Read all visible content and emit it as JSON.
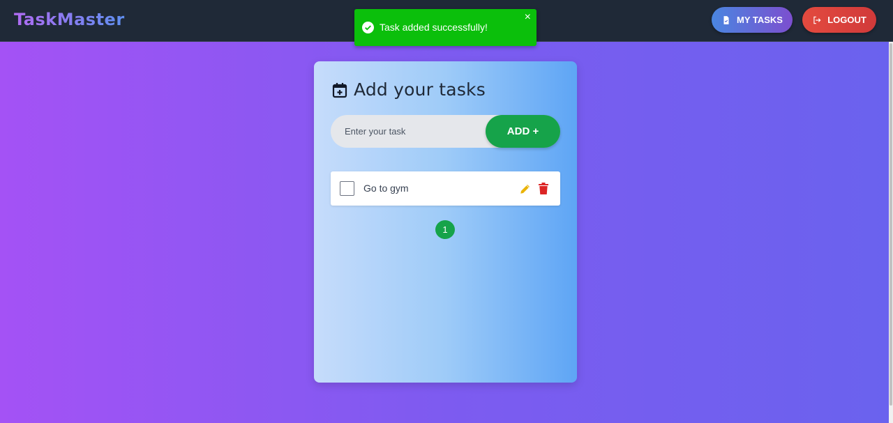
{
  "navbar": {
    "brand": "TaskMaster",
    "my_tasks_label": "MY TASKS",
    "logout_label": "LOGOUT",
    "my_tasks_icon": "document-icon",
    "logout_icon": "logout-icon"
  },
  "toast": {
    "message": "Task added successfully!",
    "close": "×",
    "icon": "check-circle-icon",
    "color": "#0bbf0b"
  },
  "card": {
    "title": "Add your tasks",
    "title_icon": "calendar-plus-icon",
    "input_placeholder": "Enter your task",
    "input_value": "",
    "add_label": "ADD +",
    "tasks": [
      {
        "text": "Go to gym",
        "completed": false,
        "edit_icon": "pencil-icon",
        "delete_icon": "trash-icon"
      }
    ],
    "pagination": {
      "current_page": "1"
    }
  },
  "colors": {
    "accent_green": "#16a34a",
    "danger_red": "#dc2626",
    "edit_yellow": "#eab308",
    "navbar_bg": "#1f2937"
  }
}
